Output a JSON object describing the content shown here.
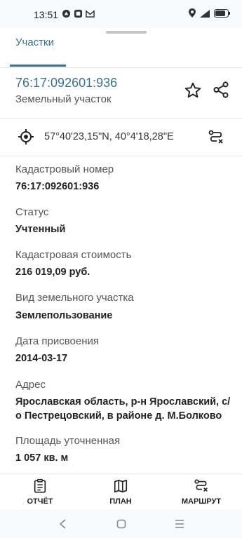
{
  "status_bar": {
    "time": "13:51"
  },
  "tabs": {
    "active_label": "Участки"
  },
  "parcel": {
    "number": "76:17:092601:936",
    "type": "Земельный участок",
    "coordinates": "57°40'23,15\"N, 40°4'18,28\"E"
  },
  "fields": [
    {
      "label": "Кадастровый номер",
      "value": "76:17:092601:936"
    },
    {
      "label": "Статус",
      "value": "Учтенный"
    },
    {
      "label": "Кадастровая стоимость",
      "value": "216 019,09 руб."
    },
    {
      "label": "Вид земельного участка",
      "value": "Землепользование"
    },
    {
      "label": "Дата присвоения",
      "value": "2014-03-17"
    },
    {
      "label": "Адрес",
      "value": "Ярославская область, р-н Ярославский, с/о Пестрецовский, в районе д. М.Болково"
    },
    {
      "label": "Площадь уточненная",
      "value": "1 057 кв. м"
    }
  ],
  "bottom_nav": {
    "report_label": "ОТЧЁТ",
    "plan_label": "ПЛАН",
    "route_label": "МАРШРУТ"
  },
  "colors": {
    "accent": "#3a6f8e",
    "text": "#212121",
    "muted": "#555555"
  },
  "icons": [
    "star-icon",
    "share-icon",
    "target-icon",
    "route-icon",
    "report-icon",
    "map-icon",
    "back-icon",
    "home-icon",
    "menu-icon"
  ]
}
